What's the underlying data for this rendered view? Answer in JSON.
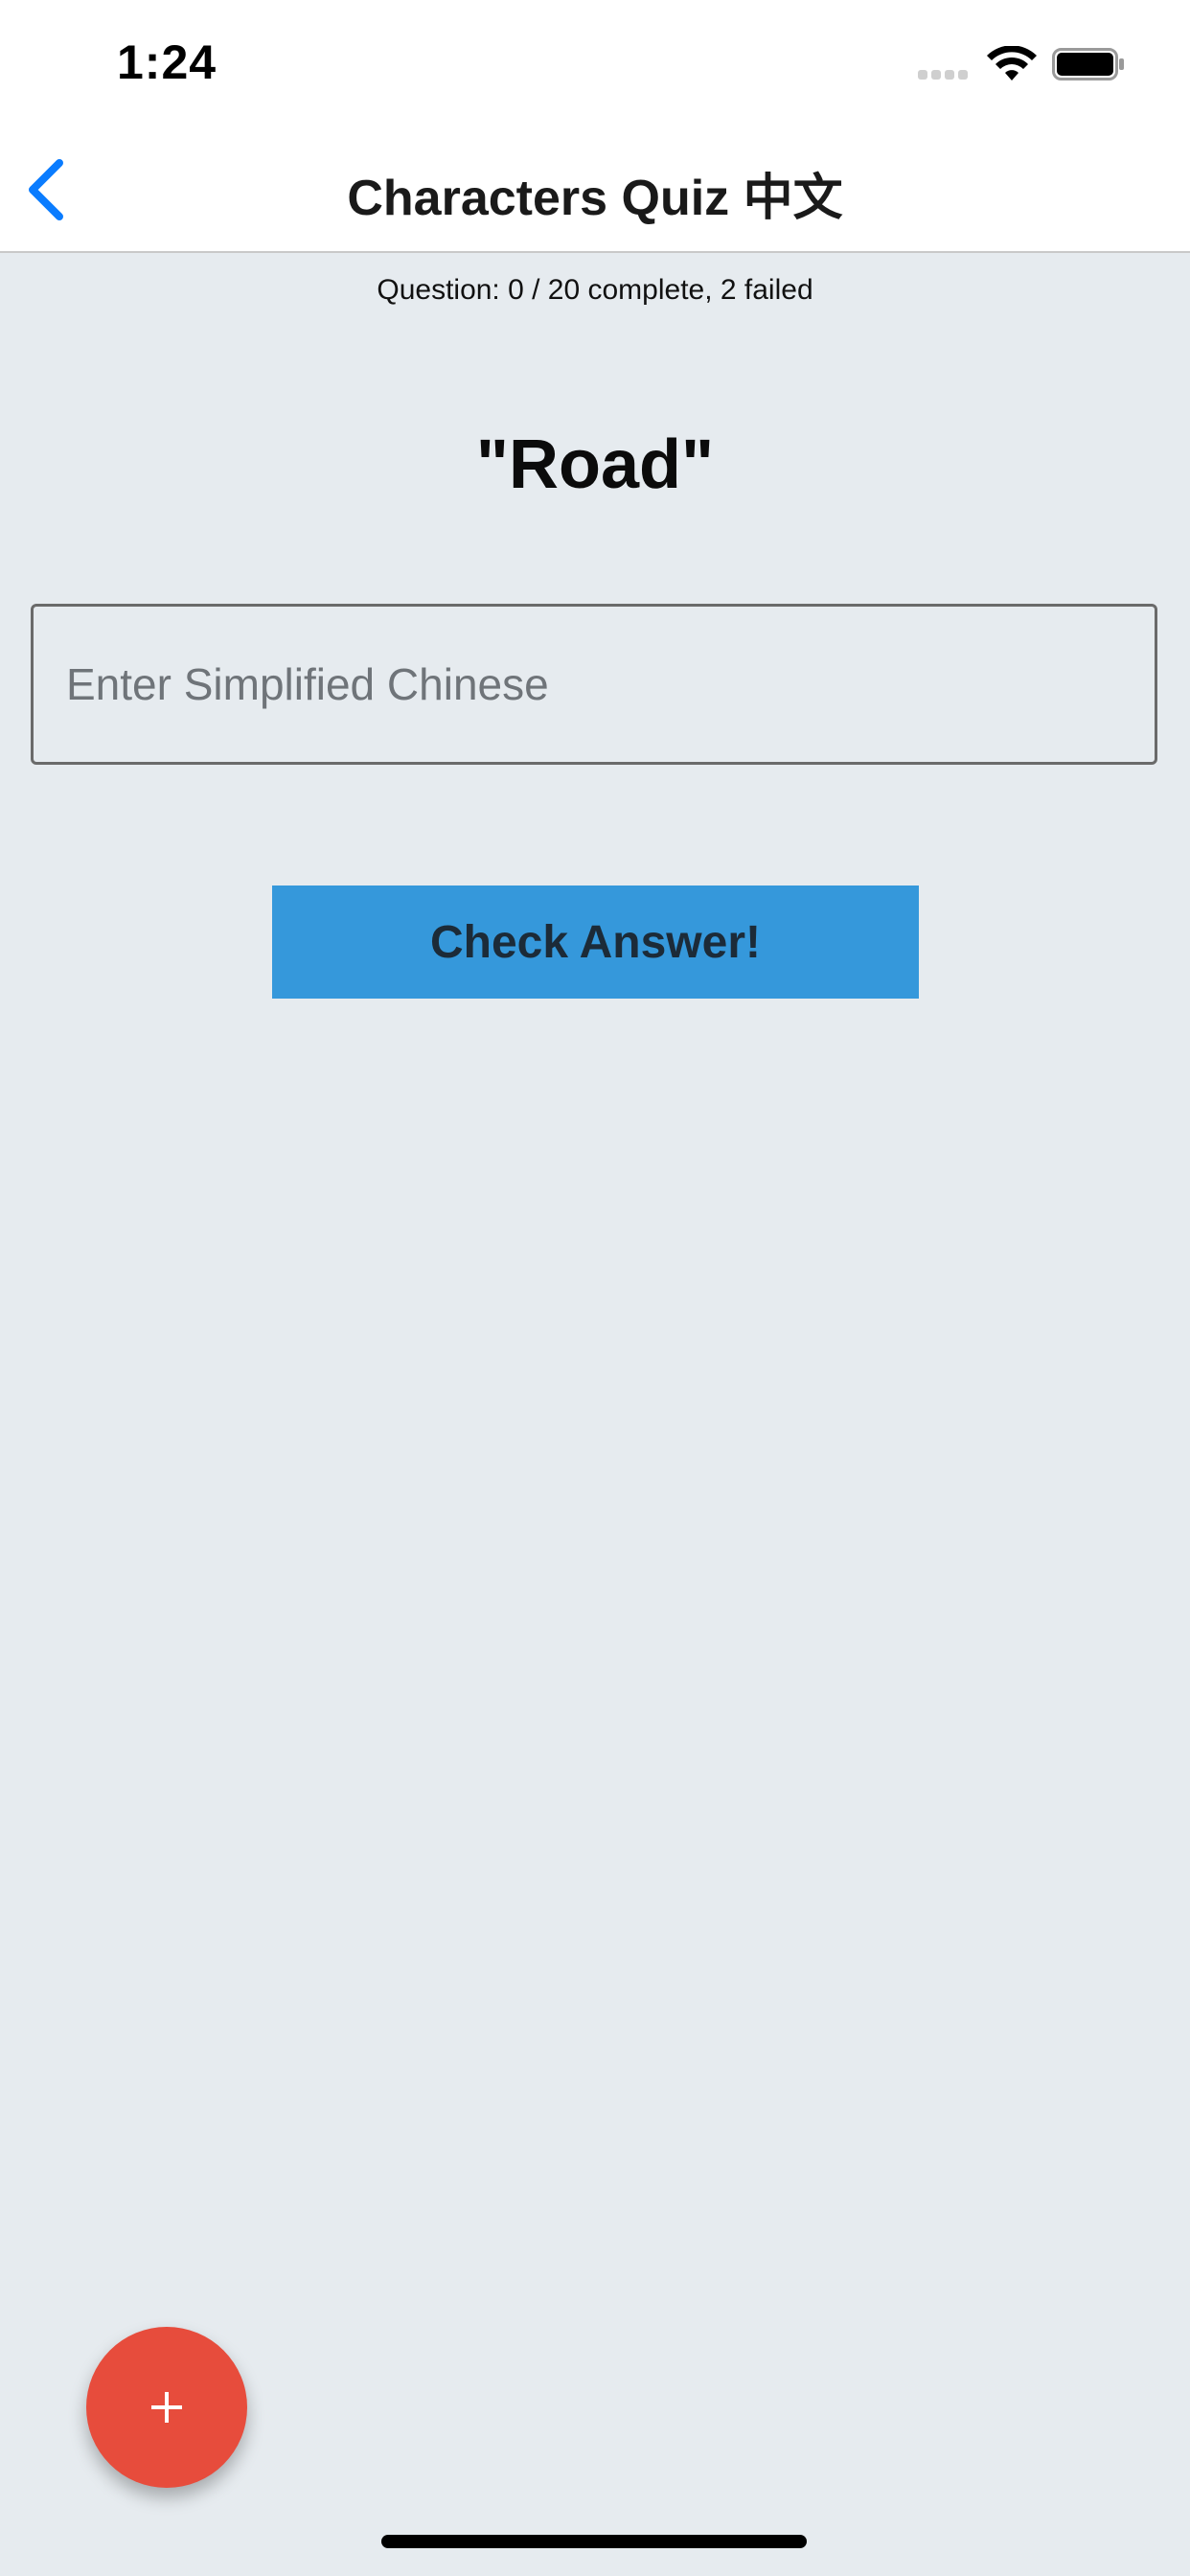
{
  "status_bar": {
    "time": "1:24"
  },
  "nav": {
    "title": "Characters Quiz 中文",
    "back_icon": "chevron-left-icon"
  },
  "quiz": {
    "progress": "Question: 0 / 20 complete, 2 failed",
    "prompt": "\"Road\"",
    "input_value": "",
    "input_placeholder": "Enter Simplified Chinese",
    "check_label": "Check Answer!"
  },
  "fab": {
    "icon": "plus-icon"
  },
  "colors": {
    "background": "#e6ebef",
    "accent_blue": "#007aff",
    "button_blue": "#3598db",
    "fab_red": "#e74c3c"
  }
}
